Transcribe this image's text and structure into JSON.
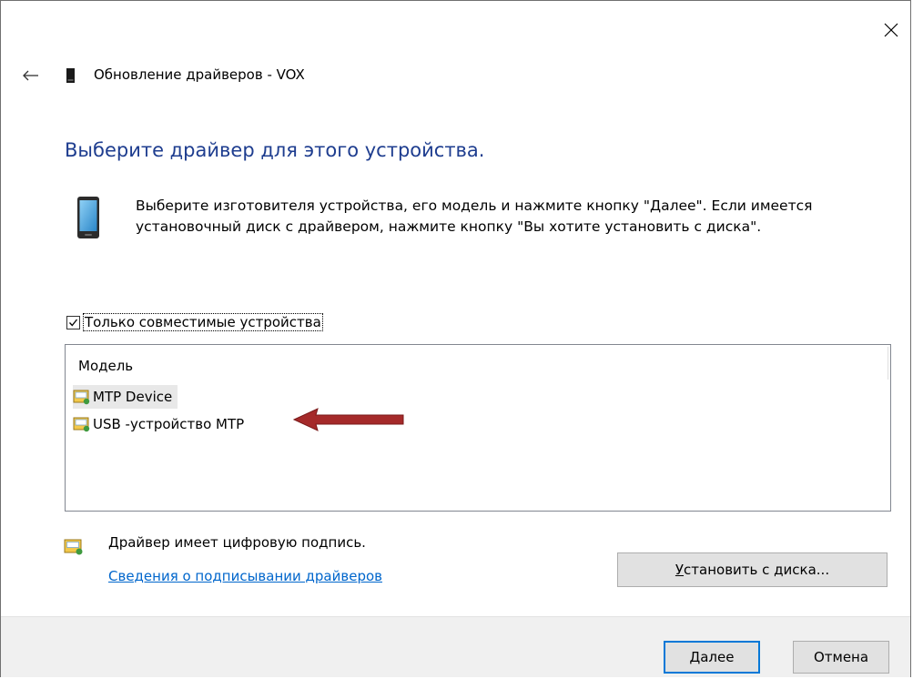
{
  "window": {
    "title": "Обновление драйверов - VOX"
  },
  "page": {
    "heading": "Выберите драйвер для этого устройства.",
    "instructions_line1": "Выберите изготовителя устройства, его модель и нажмите кнопку \"Далее\". Если имеется",
    "instructions_line2": "установочный диск с  драйвером, нажмите кнопку \"Вы хотите установить с диска\"."
  },
  "compat": {
    "label": "Только совместимые устройства",
    "checked": true
  },
  "model_list": {
    "header": "Модель",
    "items": [
      {
        "label": "MTP Device",
        "selected": true
      },
      {
        "label": "USB -устройство MTP",
        "selected": false
      }
    ]
  },
  "signature": {
    "text": "Драйвер имеет цифровую подпись.",
    "link": "Сведения о подписывании драйверов"
  },
  "buttons": {
    "have_disk_first": "У",
    "have_disk_rest": "становить с диска...",
    "next_first": "Д",
    "next_rest": "алее",
    "cancel": "Отмена"
  },
  "colors": {
    "heading": "#1e3d8f",
    "link": "#0066cc",
    "arrow": "#a52a2a",
    "focus_border": "#0078d7"
  }
}
